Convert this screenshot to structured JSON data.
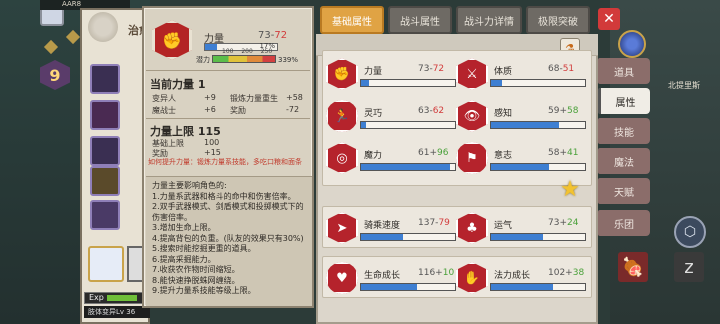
{
  "hud": {
    "top_text": "AAR8",
    "level": "9",
    "char_name": "治愈",
    "exp_label": "Exp",
    "job_line": "肢体变异Lv 36",
    "right_region_label": "北提里斯"
  },
  "detail": {
    "title": "力量",
    "value_main": "73-",
    "value_neg": "72",
    "bar_pct": "17%",
    "potential_label": "潜力",
    "potential_ticks": "100  200  250",
    "potential_pct": "339%",
    "current_title": "当前力量 1",
    "rows_a": [
      {
        "label": "变异人",
        "value": "+9",
        "label2": "锻炼力量重生",
        "value2": "+58"
      },
      {
        "label": "魔战士",
        "value": "+6",
        "label2": "奖励",
        "value2": "-72"
      }
    ],
    "limit_title": "力量上限 115",
    "rows_b": [
      {
        "label": "基础上限",
        "value": "100"
      },
      {
        "label": "奖励",
        "value": "+15"
      }
    ],
    "tip": "如何提升力量：锻炼力量系技能，多吃口粮和面条",
    "description": "力量主要影响角色的:\n1.力量系武器和格斗的命中和伤害倍率。\n2.双手武器模式、剑盾模式和投掷模式下的伤害倍率。\n3.增加生命上限。\n4.提高背包的负重。(队友的效果只有30%)\n5.搜索时能挖掘更重的道具。\n6.提高采掘能力。\n7.收获农作物时间缩短。\n8.能快速挣脱蛛网缠绕。\n9.提升力量系技能等级上限。"
  },
  "tabs": [
    {
      "label": "基础属性",
      "active": true
    },
    {
      "label": "战斗属性",
      "active": false
    },
    {
      "label": "战斗力详情",
      "active": false
    },
    {
      "label": "极限突破",
      "active": false
    }
  ],
  "attributes": [
    {
      "label": "力量",
      "base": "73-",
      "delta": "72",
      "sign": "neg",
      "fill": 0.08,
      "icon": "strength-icon",
      "glyph": "✊"
    },
    {
      "label": "体质",
      "base": "68-",
      "delta": "51",
      "sign": "neg",
      "fill": 0.12,
      "icon": "constitution-icon",
      "glyph": "⚔"
    },
    {
      "label": "灵巧",
      "base": "63-",
      "delta": "62",
      "sign": "neg",
      "fill": 0.05,
      "icon": "dexterity-icon",
      "glyph": "🏃"
    },
    {
      "label": "感知",
      "base": "59+",
      "delta": "58",
      "sign": "pos",
      "fill": 0.72,
      "icon": "perception-icon",
      "glyph": "👁"
    },
    {
      "label": "魔力",
      "base": "61+",
      "delta": "96",
      "sign": "pos",
      "fill": 0.95,
      "icon": "magic-icon",
      "glyph": "◎"
    },
    {
      "label": "意志",
      "base": "58+",
      "delta": "41",
      "sign": "pos",
      "fill": 0.62,
      "icon": "will-icon",
      "glyph": "⚑"
    },
    {
      "label": "骑乘速度",
      "base": "137-",
      "delta": "79",
      "sign": "neg",
      "fill": 0.45,
      "icon": "riding-speed-icon",
      "glyph": "➤"
    },
    {
      "label": "运气",
      "base": "73+",
      "delta": "24",
      "sign": "pos",
      "fill": 0.55,
      "icon": "luck-icon",
      "glyph": "♣"
    },
    {
      "label": "生命成长",
      "base": "116+",
      "delta": "10",
      "sign": "pos",
      "fill": 0.6,
      "icon": "life-growth-icon",
      "glyph": "♥"
    },
    {
      "label": "法力成长",
      "base": "102+",
      "delta": "38",
      "sign": "pos",
      "fill": 0.66,
      "icon": "mana-growth-icon",
      "glyph": "✋"
    }
  ],
  "right_tabs": [
    {
      "label": "道具",
      "active": false
    },
    {
      "label": "属性",
      "active": true
    },
    {
      "label": "技能",
      "active": false
    },
    {
      "label": "魔法",
      "active": false
    },
    {
      "label": "天赋",
      "active": false
    },
    {
      "label": "乐团",
      "active": false
    }
  ],
  "colors": {
    "tab_active": "#e0a344",
    "bar_fill": "#3e7fd2",
    "negative": "#d23c3c",
    "positive": "#4aa13a",
    "attr_icon": "#b5232c"
  }
}
